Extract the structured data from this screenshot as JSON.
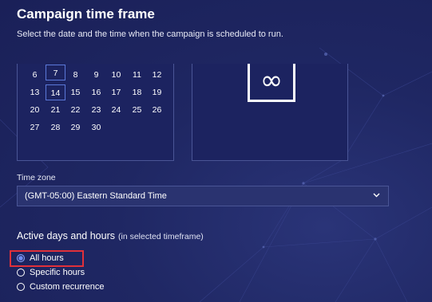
{
  "header": {
    "title": "Campaign time frame",
    "subtitle": "Select the date and the time when the campaign is scheduled to run."
  },
  "calendar": {
    "weeks": [
      [
        "6",
        "7",
        "8",
        "9",
        "10",
        "11",
        "12"
      ],
      [
        "13",
        "14",
        "15",
        "16",
        "17",
        "18",
        "19"
      ],
      [
        "20",
        "21",
        "22",
        "23",
        "24",
        "25",
        "26"
      ],
      [
        "27",
        "28",
        "29",
        "30",
        "",
        "",
        ""
      ]
    ],
    "selected_day": "7",
    "today_day": "14"
  },
  "preview": {
    "icon": "infinity-icon"
  },
  "timezone": {
    "label": "Time zone",
    "value": "(GMT-05:00) Eastern Standard Time"
  },
  "active": {
    "heading": "Active days and hours",
    "note": "(in selected timeframe)",
    "options": [
      {
        "label": "All hours",
        "checked": true
      },
      {
        "label": "Specific hours",
        "checked": false
      },
      {
        "label": "Custom recurrence",
        "checked": false
      }
    ]
  },
  "colors": {
    "background": "#1e2560",
    "panel_border": "#4a5596",
    "select_bg": "#2a3370",
    "radio_accent": "#6f8cf5",
    "highlight": "#e0303a"
  }
}
